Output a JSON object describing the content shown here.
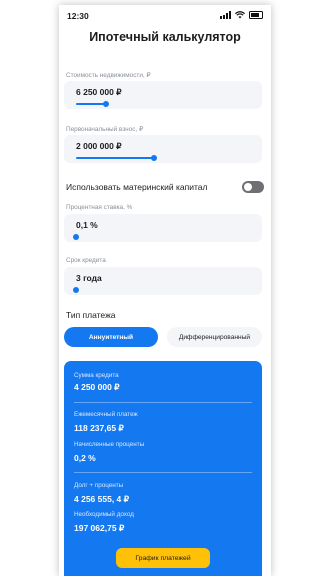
{
  "status": {
    "time": "12:30"
  },
  "title": "Ипотечный калькулятор",
  "fields": [
    {
      "label": "Стоимость недвижимости, ₽",
      "value": "6 250 000 ₽",
      "slider_fraction": 0.17
    },
    {
      "label": "Первоначальный взнос, ₽",
      "value": "2 000 000 ₽",
      "slider_fraction": 0.45
    },
    {
      "label": "Процентная ставка, %",
      "value": "0,1 %",
      "slider_fraction": 0.0
    },
    {
      "label": "Срок кредита",
      "value": "3 года",
      "slider_fraction": 0.0
    }
  ],
  "maternity_capital": {
    "label": "Использовать материнский капитал",
    "enabled": false
  },
  "payment_type": {
    "title": "Тип платежа",
    "options": [
      "Аннуитетный",
      "Дифференцированный"
    ],
    "selected": "Аннуитетный"
  },
  "results": {
    "loan_amount_label": "Сумма кредита",
    "loan_amount": "4 250 000 ₽",
    "monthly_payment_label": "Ежемесячный платеж",
    "monthly_payment": "118 237,65 ₽",
    "interest_label": "Начисленные проценты",
    "interest": "0,2 %",
    "debt_interest_label": "Долг + проценты",
    "debt_interest": "4 256 555, 4 ₽",
    "income_label": "Необходимый доход",
    "income": "197 062,75 ₽"
  },
  "schedule_button": "График платежей",
  "colors": {
    "accent": "#1479f0",
    "button": "#ffc107",
    "card": "#f3f5f9"
  }
}
